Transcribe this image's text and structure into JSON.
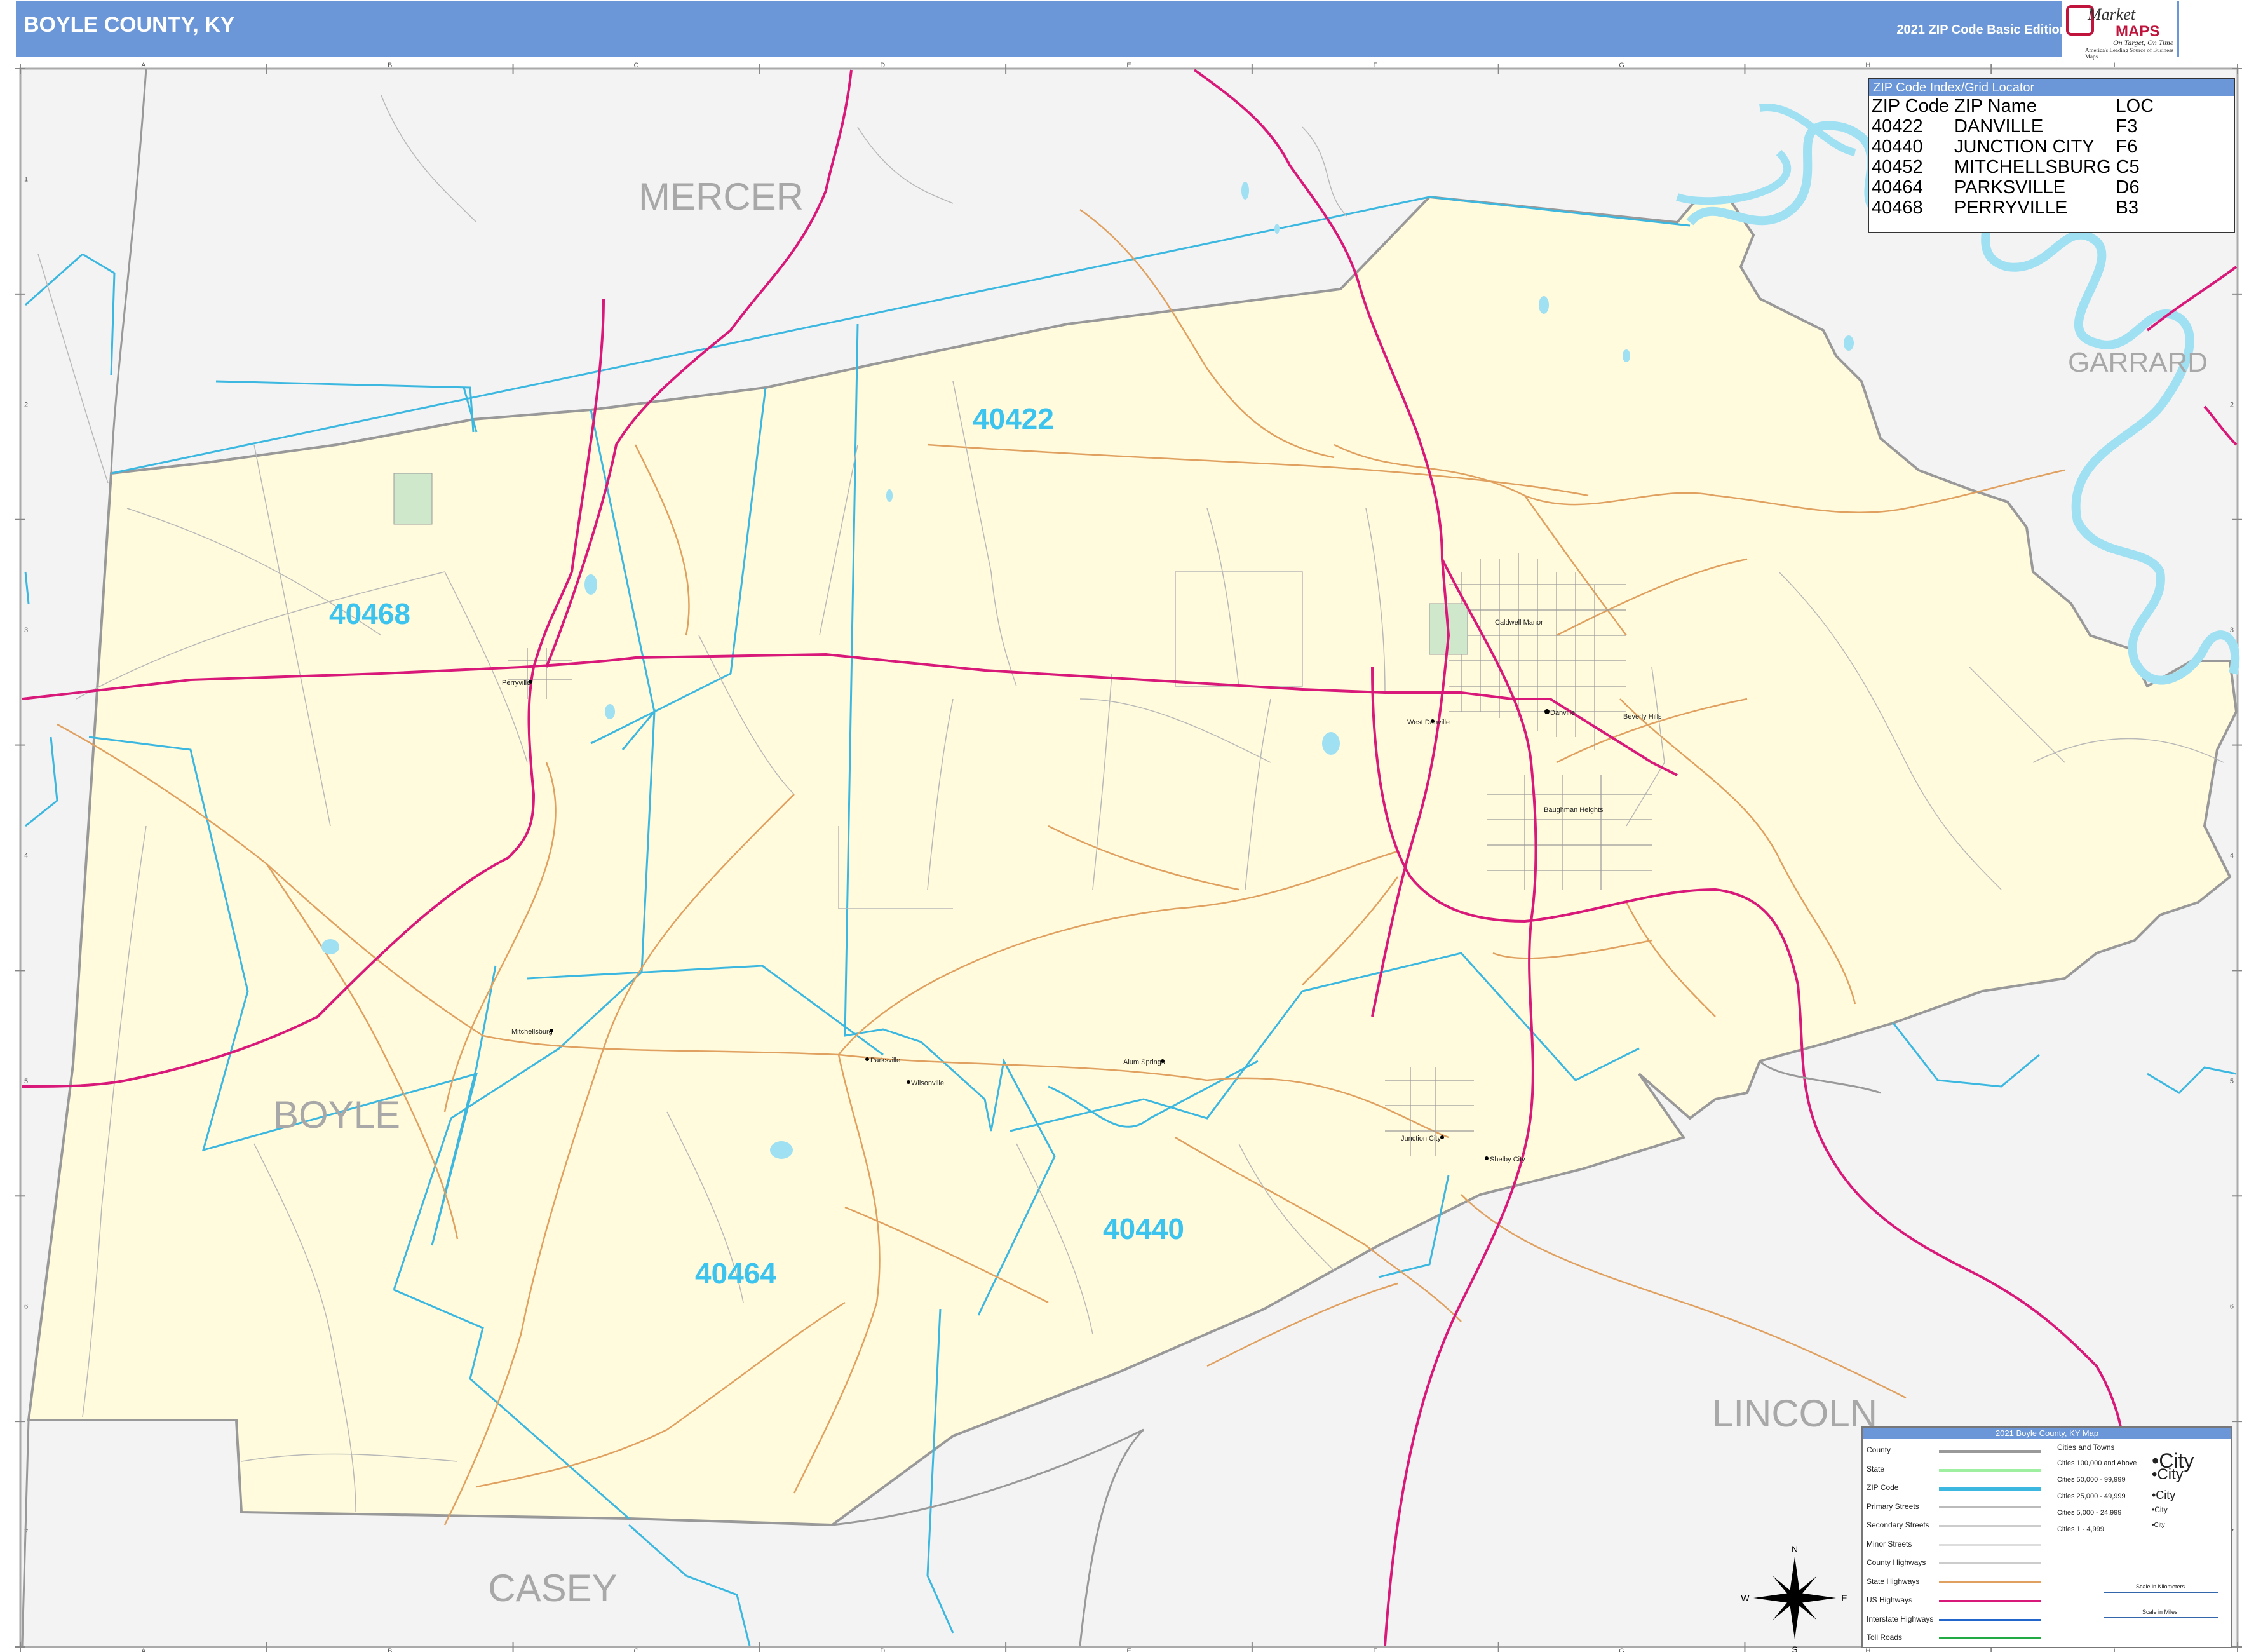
{
  "header": {
    "title": "BOYLE COUNTY, KY",
    "edition": "2021 ZIP Code Basic Edition",
    "logo_line1": "Market",
    "logo_line2": "MAPS",
    "logo_tagline": "On Target, On Time",
    "logo_sub": "America's Leading Source of Business Maps"
  },
  "counties": [
    "MERCER",
    "GARRARD",
    "BOYLE",
    "LINCOLN",
    "CASEY"
  ],
  "zip_labels": [
    "40422",
    "40468",
    "40464",
    "40440"
  ],
  "places": [
    "Danville",
    "West Danville",
    "Junction City",
    "Shelby City",
    "Perryville",
    "Parksville",
    "Mitchellsburg",
    "Alum Springs",
    "Wilsonville",
    "Caldwell Manor",
    "Beverly Hills",
    "Baughman Heights"
  ],
  "grid": {
    "columns": [
      "A",
      "B",
      "C",
      "D",
      "E",
      "F",
      "G",
      "H",
      "I"
    ],
    "rows": [
      "1",
      "2",
      "3",
      "4",
      "5",
      "6",
      "7"
    ]
  },
  "zip_index": {
    "title": "ZIP Code Index/Grid Locator",
    "headers": [
      "ZIP Code",
      "ZIP Name",
      "LOC"
    ],
    "rows": [
      [
        "40422",
        "DANVILLE",
        "F3"
      ],
      [
        "40440",
        "JUNCTION CITY",
        "F6"
      ],
      [
        "40452",
        "MITCHELLSBURG",
        "C5"
      ],
      [
        "40464",
        "PARKSVILLE",
        "D6"
      ],
      [
        "40468",
        "PERRYVILLE",
        "B3"
      ]
    ]
  },
  "legend": {
    "title": "2021 Boyle County, KY Map",
    "items": [
      "County",
      "State",
      "ZIP Code",
      "Primary Streets",
      "Secondary Streets",
      "Minor Streets",
      "County Highways",
      "State Highways",
      "US Highways",
      "Interstate Highways",
      "Toll Roads"
    ],
    "cities_title": "Cities and Towns",
    "city_tiers": [
      "Cities 100,000 and Above",
      "Cities 50,000 - 99,999",
      "Cities 25,000 - 49,999",
      "Cities 5,000 - 24,999",
      "Cities 1 - 4,999"
    ],
    "city_sample": "City",
    "scale_km": "Scale in Kilometers",
    "scale_mi": "Scale in Miles"
  },
  "compass": [
    "N",
    "E",
    "S",
    "W"
  ],
  "colors": {
    "header": "#6b96d8",
    "county_fill": "#fffbdc",
    "outside_fill": "#f3f3f3",
    "zip_boundary": "#3cb8e0",
    "us_highway": "#d8197a",
    "state_highway": "#e0a060",
    "water": "#9fe0f3"
  }
}
